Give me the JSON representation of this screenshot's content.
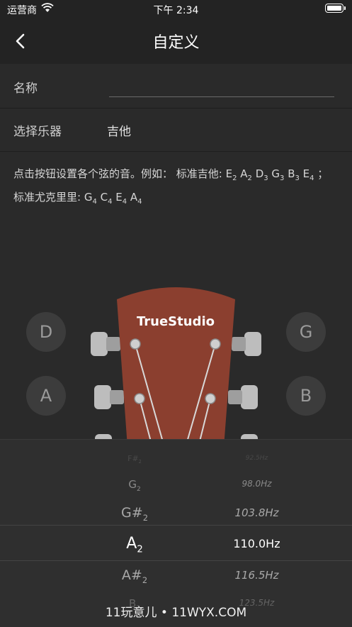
{
  "status_bar": {
    "carrier": "运营商",
    "time": "下午 2:34"
  },
  "nav": {
    "title": "自定义",
    "back_icon": "chevron-left-icon"
  },
  "form": {
    "name_label": "名称",
    "name_value": "",
    "instrument_label": "选择乐器",
    "instrument_value": "吉他"
  },
  "description": {
    "line1_prefix": "点击按钮设置各个弦的音。例如：",
    "guitar_label": "标准吉他: ",
    "guitar_notes": [
      "E2",
      "A2",
      "D3",
      "G3",
      "B3",
      "E4"
    ],
    "ukulele_label": "标准尤克里里: ",
    "ukulele_notes": [
      "G4",
      "C4",
      "E4",
      "A4"
    ]
  },
  "headstock": {
    "brand": "TrueStudio",
    "brand_color": "#8b3f2f",
    "pegs_left": [
      "D",
      "A"
    ],
    "pegs_right": [
      "G",
      "B"
    ]
  },
  "picker": {
    "items": [
      {
        "note": "F#2",
        "freq": "92.5Hz"
      },
      {
        "note": "G2",
        "freq": "98.0Hz"
      },
      {
        "note": "G#2",
        "freq": "103.8Hz"
      },
      {
        "note": "A2",
        "freq": "110.0Hz"
      },
      {
        "note": "A#2",
        "freq": "116.5Hz"
      },
      {
        "note": "B2",
        "freq": "123.5Hz"
      }
    ],
    "selected_index": 3
  },
  "watermark": "11玩意儿 • 11WYX.COM"
}
